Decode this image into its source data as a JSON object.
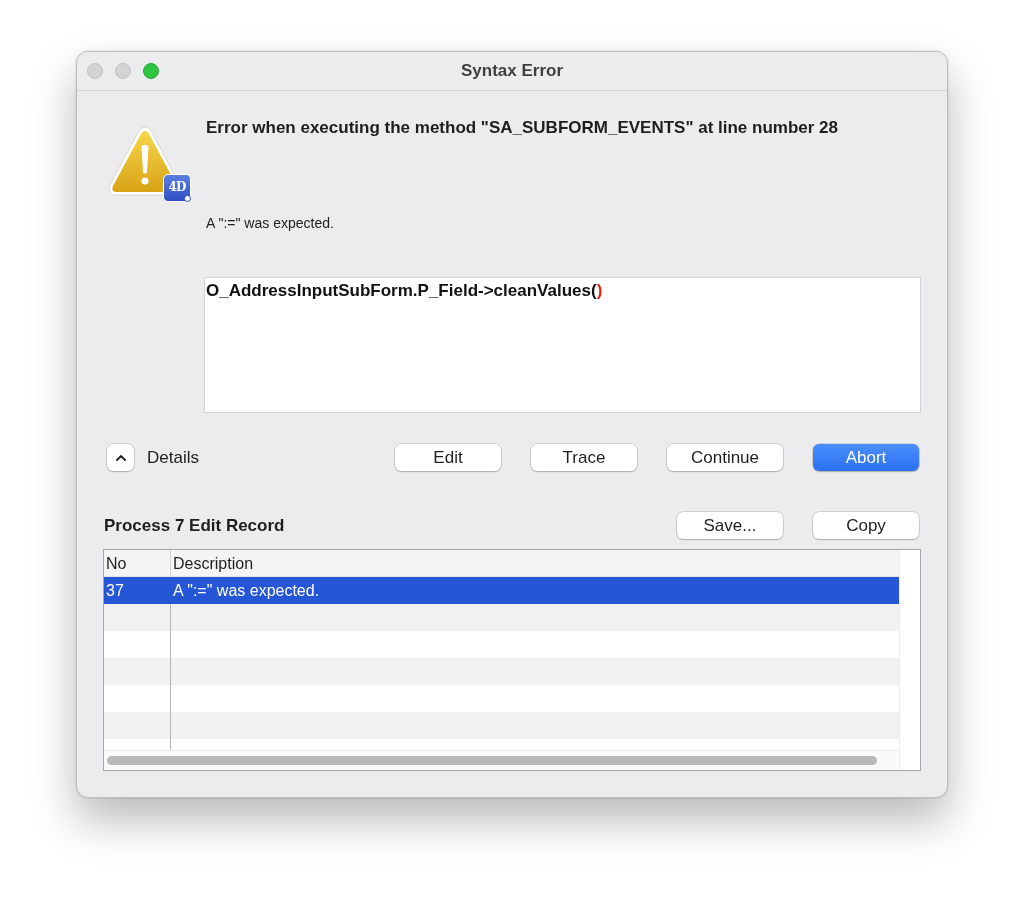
{
  "window": {
    "title": "Syntax Error",
    "controls": [
      {
        "kind": "close",
        "disabled": true
      },
      {
        "kind": "minimize",
        "disabled": true
      },
      {
        "kind": "zoom",
        "disabled": false
      }
    ]
  },
  "alert": {
    "badge": "4D",
    "message": "Error when executing the method \"SA_SUBFORM_EVENTS\" at line number 28",
    "detail": "A \":=\" was expected.",
    "code": "O_AddressInputSubForm.P_Field->cleanValues(",
    "code_error": ")"
  },
  "details": {
    "label": "Details",
    "expanded": true
  },
  "buttons": [
    {
      "label": "Edit",
      "default": false
    },
    {
      "label": "Trace",
      "default": false
    },
    {
      "label": "Continue",
      "default": false
    },
    {
      "label": "Abort",
      "default": true
    }
  ],
  "log": {
    "title": "Process 7 Edit Record",
    "buttons": [
      {
        "label": "Save...",
        "default": false
      },
      {
        "label": "Copy",
        "default": false
      }
    ],
    "table": {
      "columns": [
        "No",
        "Description"
      ],
      "rows": [
        {
          "cells": [
            "37",
            "A \":=\" was expected."
          ],
          "selected": true
        }
      ]
    }
  }
}
